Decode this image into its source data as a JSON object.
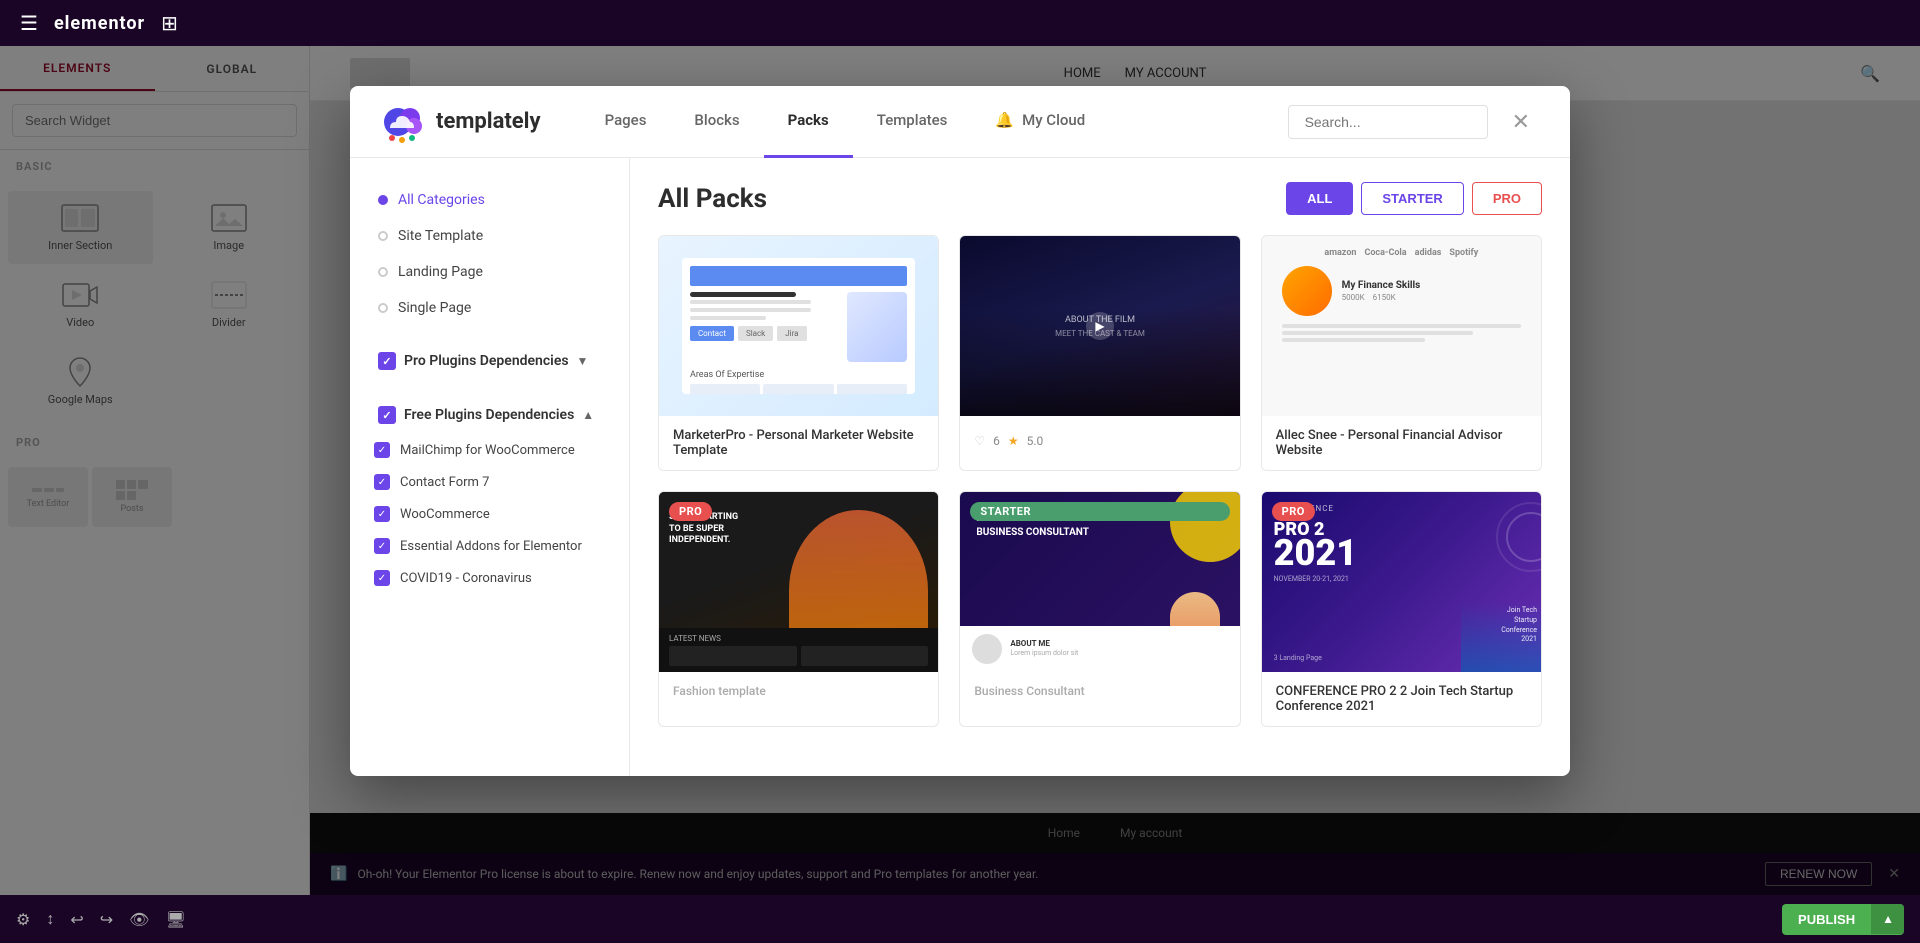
{
  "app": {
    "title": "elementor",
    "top_bar": {
      "logo": "elementor"
    }
  },
  "sidebar": {
    "tabs": [
      {
        "id": "elements",
        "label": "ELEMENTS",
        "active": true
      },
      {
        "id": "global",
        "label": "GLOBAL",
        "active": false
      }
    ],
    "search_placeholder": "Search Widget",
    "sections": [
      {
        "label": "BASIC",
        "widgets": [
          {
            "id": "inner-section",
            "label": "Inner Section",
            "icon": "inner-section-icon"
          },
          {
            "id": "image",
            "label": "Image",
            "icon": "image-icon"
          },
          {
            "id": "video",
            "label": "Video",
            "icon": "video-icon"
          },
          {
            "id": "divider",
            "label": "Divider",
            "icon": "divider-icon"
          },
          {
            "id": "google-maps",
            "label": "Google Maps",
            "icon": "maps-icon"
          }
        ]
      },
      {
        "label": "PRO",
        "widgets": []
      }
    ]
  },
  "bottom_bar": {
    "publish_label": "PUBLISH",
    "notification": {
      "icon": "info-icon",
      "text": "Oh-oh! Your Elementor Pro license is about to expire. Renew now and enjoy updates, support and Pro templates for another year.",
      "renew_label": "RENEW NOW",
      "close_icon": "close-icon"
    }
  },
  "modal": {
    "logo_text": "templately",
    "close_icon": "close-icon",
    "nav_items": [
      {
        "id": "pages",
        "label": "Pages",
        "active": false
      },
      {
        "id": "blocks",
        "label": "Blocks",
        "active": false
      },
      {
        "id": "packs",
        "label": "Packs",
        "active": true
      },
      {
        "id": "templates",
        "label": "Templates",
        "active": false
      },
      {
        "id": "my-cloud",
        "label": "My Cloud",
        "active": false
      }
    ],
    "search_placeholder": "Search...",
    "sidebar": {
      "categories": [
        {
          "id": "all",
          "label": "All Categories",
          "active": true
        },
        {
          "id": "site-template",
          "label": "Site Template",
          "active": false
        },
        {
          "id": "landing-page",
          "label": "Landing Page",
          "active": false
        },
        {
          "id": "single-page",
          "label": "Single Page",
          "active": false
        }
      ],
      "filters": [
        {
          "id": "pro-plugins",
          "label": "Pro Plugins Dependencies",
          "checked": true,
          "expanded": false,
          "items": []
        },
        {
          "id": "free-plugins",
          "label": "Free Plugins Dependencies",
          "checked": true,
          "expanded": true,
          "items": [
            {
              "id": "mailchimp",
              "label": "MailChimp for WooCommerce",
              "checked": true
            },
            {
              "id": "contact-form",
              "label": "Contact Form 7",
              "checked": true
            },
            {
              "id": "woocommerce",
              "label": "WooCommerce",
              "checked": true
            },
            {
              "id": "essential-addons",
              "label": "Essential Addons for Elementor",
              "checked": true
            },
            {
              "id": "covid19",
              "label": "COVID19 - Coronavirus",
              "checked": true
            }
          ]
        }
      ]
    },
    "main": {
      "title": "All Packs",
      "filter_buttons": [
        {
          "id": "all",
          "label": "ALL",
          "active": true
        },
        {
          "id": "starter",
          "label": "STARTER",
          "active": false
        },
        {
          "id": "pro",
          "label": "PRO",
          "active": false
        }
      ],
      "templates": [
        {
          "id": "marketer-pro",
          "title": "MarketerPro - Personal Marketer Website Template",
          "badge": null,
          "likes": null,
          "rating": null,
          "type": "marketer"
        },
        {
          "id": "film",
          "title": "",
          "badge": null,
          "likes": "6",
          "rating": "5.0",
          "type": "film"
        },
        {
          "id": "allec-snee",
          "title": "Allec Snee - Personal Financial Advisor Website",
          "badge": null,
          "likes": null,
          "rating": null,
          "type": "finance"
        },
        {
          "id": "fashion",
          "title": "",
          "badge": "PRO",
          "badge_type": "pro",
          "likes": null,
          "rating": null,
          "type": "fashion"
        },
        {
          "id": "consultant",
          "title": "",
          "badge": "STARTER",
          "badge_type": "starter",
          "likes": null,
          "rating": null,
          "type": "consultant"
        },
        {
          "id": "conference",
          "title": "CONFERENCE PRO 2 2 Join Tech Startup Conference 2021",
          "badge": "PRO",
          "badge_type": "pro",
          "likes": null,
          "rating": null,
          "type": "conference"
        }
      ]
    }
  },
  "website": {
    "nav_links": [
      "HOME",
      "MY ACCOUNT"
    ],
    "search_icon": "search-icon"
  }
}
